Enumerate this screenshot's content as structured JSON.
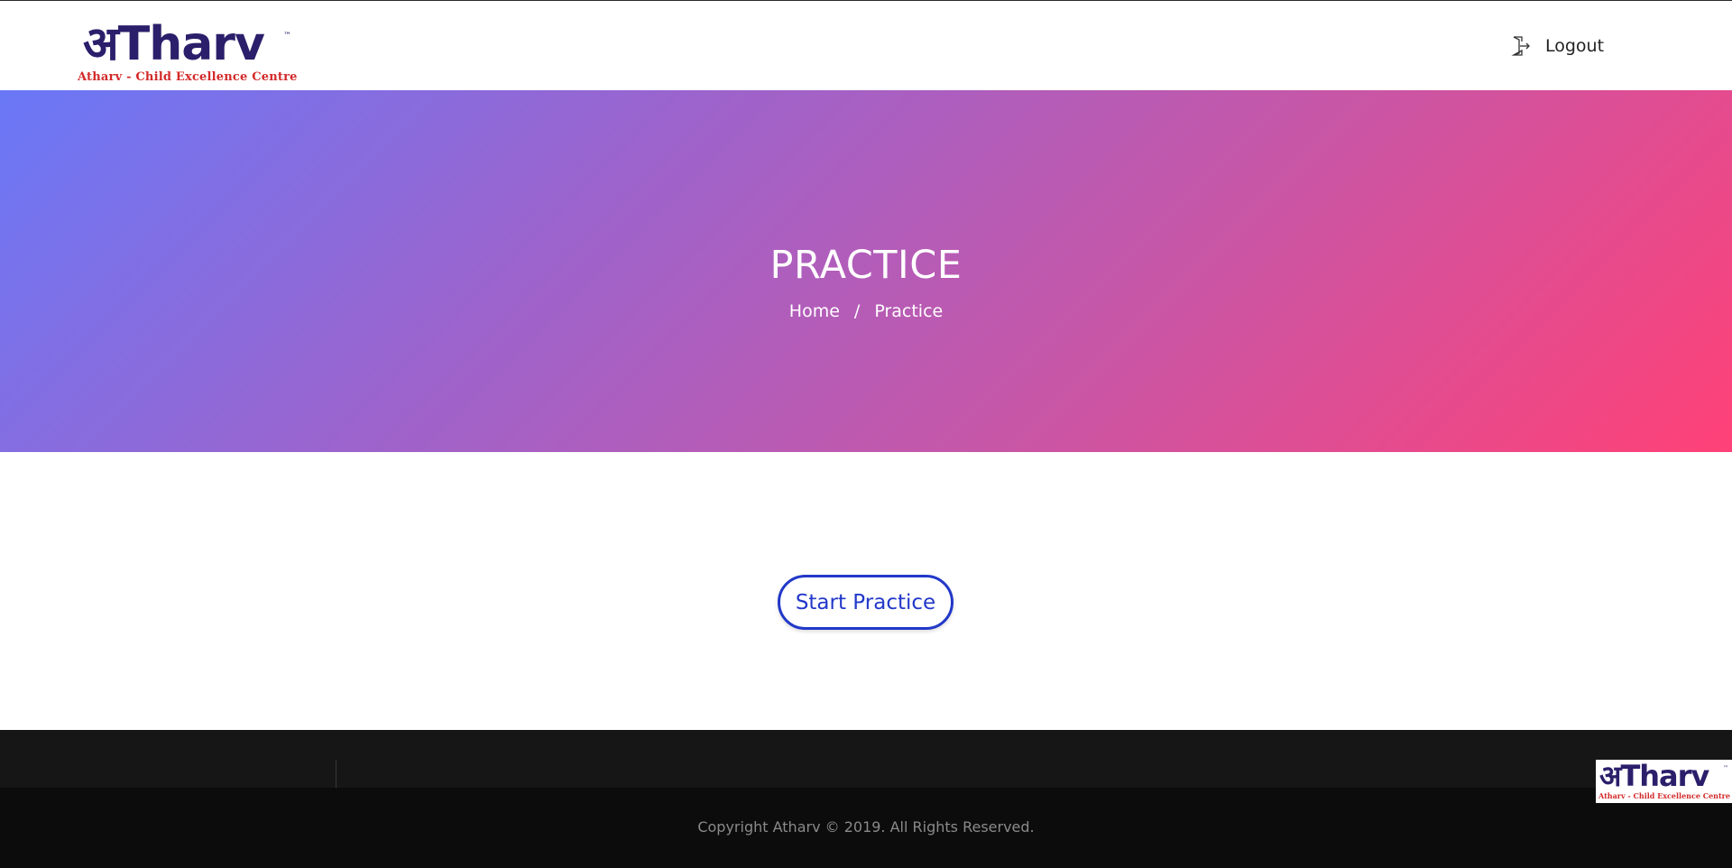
{
  "header": {
    "logo": {
      "main_text": "अTharv",
      "tm": "™",
      "subtitle": "Atharv - Child Excellence Centre"
    },
    "logout_label": "Logout"
  },
  "hero": {
    "title": "PRACTICE",
    "breadcrumb": {
      "home": "Home",
      "separator": "/",
      "current": "Practice"
    }
  },
  "main": {
    "start_button_label": "Start Practice"
  },
  "footer": {
    "copyright": "Copyright Atharv © 2019. All Rights Reserved.",
    "logo": {
      "main_text": "अTharv",
      "tm": "™",
      "subtitle": "Atharv - Child Excellence Centre"
    }
  },
  "colors": {
    "brand_navy": "#2b1f6b",
    "brand_red": "#d32a2a",
    "button_blue": "#2238c9",
    "gradient_start": "#6a78f7",
    "gradient_end": "#ff4177"
  },
  "icons": {
    "logout": "logout-icon"
  }
}
